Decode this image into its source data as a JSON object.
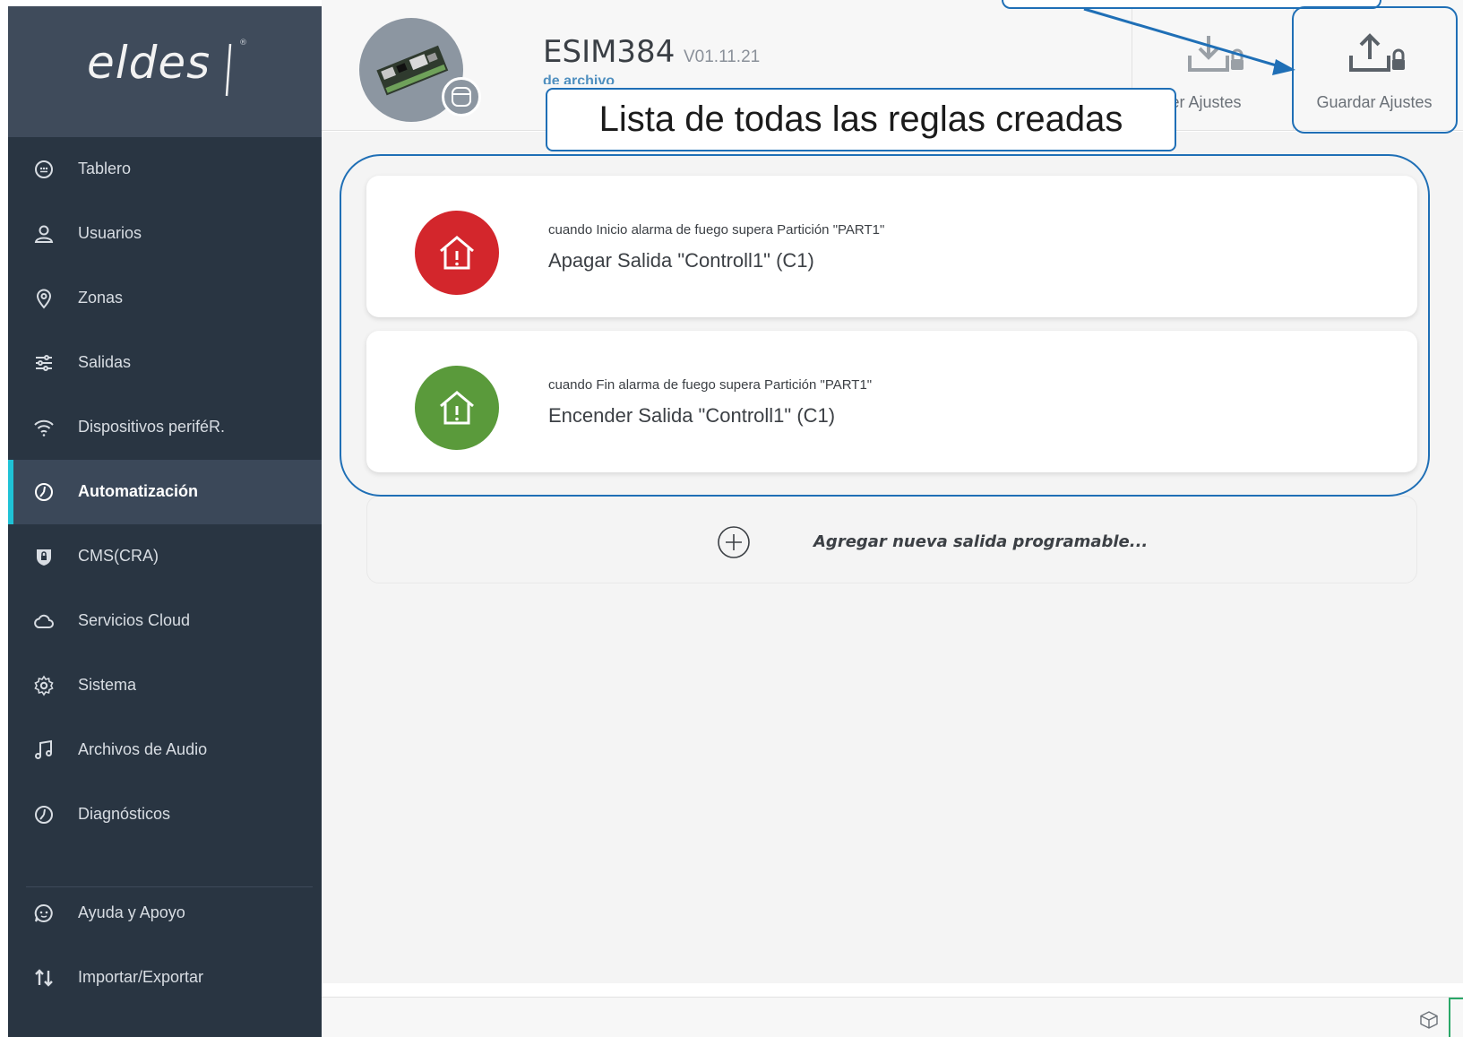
{
  "sidebar": {
    "logo": "eldes",
    "logo_mark": "®",
    "items": [
      {
        "label": "Tablero",
        "icon": "dashboard-icon",
        "active": false
      },
      {
        "label": "Usuarios",
        "icon": "user-icon",
        "active": false
      },
      {
        "label": "Zonas",
        "icon": "location-pin-icon",
        "active": false
      },
      {
        "label": "Salidas",
        "icon": "sliders-icon",
        "active": false
      },
      {
        "label": "Dispositivos periféR.",
        "icon": "wifi-icon",
        "active": false
      },
      {
        "label": "Automatización",
        "icon": "clock-icon",
        "active": true
      },
      {
        "label": "CMS(CRA)",
        "icon": "shield-lock-icon",
        "active": false
      },
      {
        "label": "Servicios Cloud",
        "icon": "cloud-icon",
        "active": false
      },
      {
        "label": "Sistema",
        "icon": "gear-icon",
        "active": false
      },
      {
        "label": "Archivos de Audio",
        "icon": "music-note-icon",
        "active": false
      },
      {
        "label": "Diagnósticos",
        "icon": "clock-icon",
        "active": false
      },
      {
        "label": "Ayuda y Apoyo",
        "icon": "chat-help-icon",
        "active": false
      },
      {
        "label": "Importar/Exportar",
        "icon": "import-export-icon",
        "active": false
      }
    ]
  },
  "header": {
    "device_name": "ESIM384",
    "device_version": "V01.11.21",
    "device_subtitle": "de archivo",
    "read_label": "Leer Ajustes",
    "save_label": "Guardar Ajustes"
  },
  "rules": [
    {
      "condition": "cuando Inicio alarma de fuego supera Partición \"PART1\"",
      "action": "Apagar Salida \"Controll1\" (C1)",
      "icon": "house-alert-icon",
      "color": "#d3262c"
    },
    {
      "condition": "cuando Fin alarma de fuego supera Partición \"PART1\"",
      "action": "Encender Salida \"Controll1\" (C1)",
      "icon": "house-alert-icon",
      "color": "#5a9a3b"
    }
  ],
  "add_rule_label": "Agregar nueva salida programable...",
  "annotation": {
    "rules_callout": "Lista de todas las reglas creadas"
  },
  "colors": {
    "sidebar_bg": "#293542",
    "accent": "#1fc2d6",
    "annotation": "#1f6fb6"
  }
}
